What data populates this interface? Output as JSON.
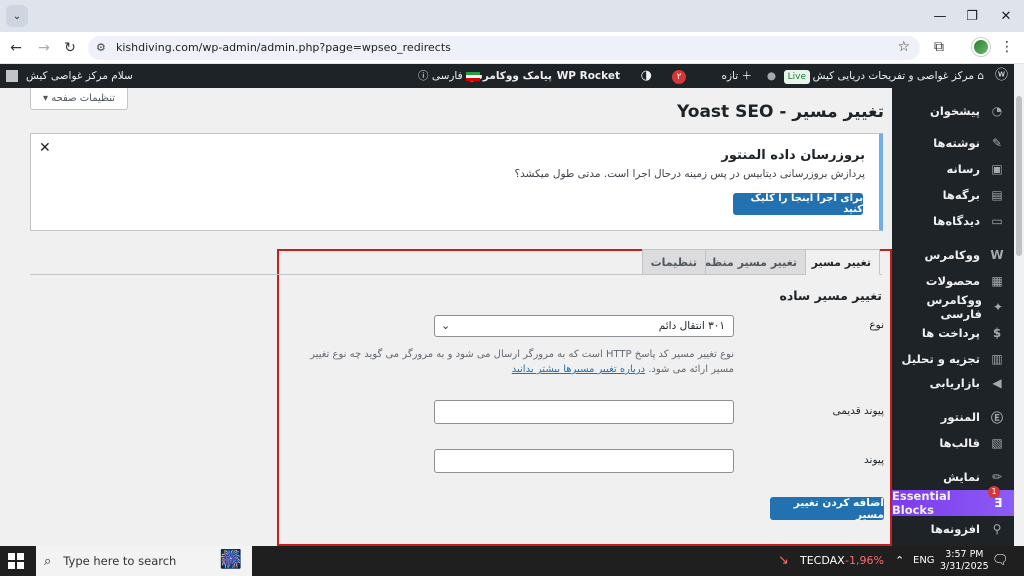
{
  "browser": {
    "url": "kishdiving.com/wp-admin/admin.php?page=wpseo_redirects"
  },
  "adminbar": {
    "site_name": "مرکز غواصی و تفریحات دریایی کیش",
    "live_badge": "Live",
    "new_label": "تازه",
    "yoast_count": "۲",
    "wp_rocket": "WP Rocket",
    "sms_woo": "پیامک ووکامرس",
    "language": "فارسی",
    "greeting": "سلام مرکز غواصی کیش"
  },
  "sidebar": {
    "items": [
      {
        "label": "پیشخوان",
        "icon": "dashboard-icon"
      },
      {
        "label": "نوشته‌ها",
        "icon": "pin-icon"
      },
      {
        "label": "رسانه",
        "icon": "media-icon"
      },
      {
        "label": "برگه‌ها",
        "icon": "pages-icon"
      },
      {
        "label": "دیدگاه‌ها",
        "icon": "comments-icon"
      },
      {
        "label": "ووکامرس",
        "icon": "woocommerce-icon"
      },
      {
        "label": "محصولات",
        "icon": "products-icon"
      },
      {
        "label": "ووکامرس فارسی",
        "icon": "woo-persian-icon"
      },
      {
        "label": "پرداخت ها",
        "icon": "payments-icon"
      },
      {
        "label": "تجزیه و تحلیل",
        "icon": "analytics-icon"
      },
      {
        "label": "بازاریابی",
        "icon": "marketing-icon"
      },
      {
        "label": "المنتور",
        "icon": "elementor-icon"
      },
      {
        "label": "قالب‌ها",
        "icon": "templates-icon"
      },
      {
        "label": "نمایش",
        "icon": "appearance-icon"
      },
      {
        "label": "Essential Blocks",
        "icon": "essential-blocks-icon",
        "badge": "1"
      },
      {
        "label": "افزونه‌ها",
        "icon": "plugins-icon"
      }
    ]
  },
  "page": {
    "screen_options": "تنظیمات صفحه",
    "title": "تغییر مسیر - Yoast SEO",
    "notice": {
      "title": "بروزرسان داده المنتور",
      "description": "پردازش بروزرسانی دیتابیس در پس زمینه درحال اجرا است. مدتی طول میکشد؟",
      "button": "برای اجرا اینجا را کلیک کنید"
    },
    "tabs": [
      "تغییر مسیر",
      "تغییر مسیر منظم",
      "تنظیمات"
    ],
    "section_title": "تغییر مسیر ساده",
    "type_label": "نوع",
    "type_value": "۳۰۱ انتقال دائم",
    "help_text": "نوع تغییر مسیر کد پاسخ HTTP است که به مرورگر ارسال می شود و به مرورگر می گوید چه نوع تغییر مسیر ارائه می شود.",
    "help_link": "درباره تغییر مسیرها بیشتر بدانید",
    "old_url_label": "پیوند قدیمی",
    "url_label": "پیوند",
    "add_button": "اضافه کردن تغییر مسیر"
  },
  "taskbar": {
    "search_placeholder": "Type here to search",
    "ticker": "TECDAX",
    "ticker_change": "-1,96%",
    "lang": "ENG",
    "time": "3:57 PM",
    "date": "3/31/2025"
  }
}
